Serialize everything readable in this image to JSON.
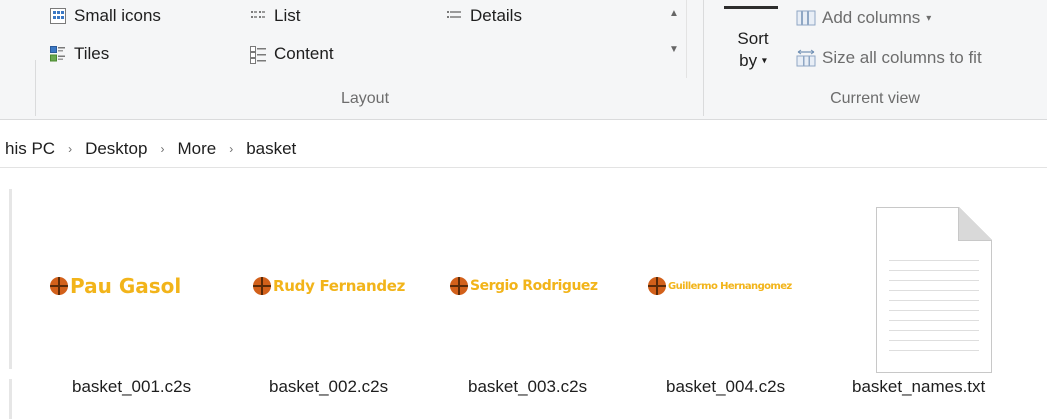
{
  "ribbon": {
    "layout": {
      "options": [
        {
          "label": "Small icons",
          "icon": "small-icons-icon"
        },
        {
          "label": "List",
          "icon": "list-icon"
        },
        {
          "label": "Details",
          "icon": "details-icon"
        },
        {
          "label": "Tiles",
          "icon": "tiles-icon"
        },
        {
          "label": "Content",
          "icon": "content-icon"
        }
      ],
      "group_label": "Layout"
    },
    "current_view": {
      "sort_label_top": "Sort",
      "sort_label_bottom": "by",
      "add_columns": "Add columns",
      "size_columns": "Size all columns to fit",
      "group_label": "Current view"
    }
  },
  "breadcrumb": [
    "his PC",
    "Desktop",
    "More",
    "basket"
  ],
  "files": [
    {
      "name": "basket_001.c2s",
      "player": "Pau Gasol"
    },
    {
      "name": "basket_002.c2s",
      "player": "Rudy Fernandez"
    },
    {
      "name": "basket_003.c2s",
      "player": "Sergio Rodriguez"
    },
    {
      "name": "basket_004.c2s",
      "player": "Guillermo Hernangomez"
    },
    {
      "name": "basket_names.txt",
      "icon": "text-document-icon"
    }
  ],
  "colors": {
    "player_text": "#f2b41a",
    "basketball": "#d2601a",
    "ribbon_bg": "#f5f6f7"
  }
}
